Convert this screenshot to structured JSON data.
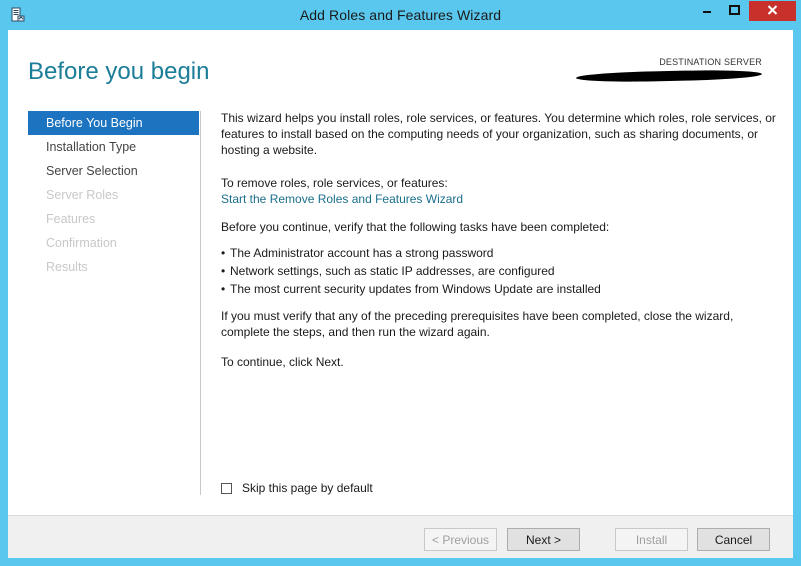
{
  "window": {
    "title": "Add Roles and Features Wizard",
    "accent_color": "#5ac8ee",
    "close_color": "#c7302b",
    "icons": {
      "app": "server-manager-icon",
      "minimize": "minimize-icon",
      "maximize": "maximize-icon",
      "close": "close-icon"
    }
  },
  "header": {
    "page_title": "Before you begin",
    "destination_label": "DESTINATION SERVER",
    "destination_value_redacted": true
  },
  "sidebar": {
    "items": [
      {
        "label": "Before You Begin",
        "state": "active"
      },
      {
        "label": "Installation Type",
        "state": "enabled"
      },
      {
        "label": "Server Selection",
        "state": "enabled"
      },
      {
        "label": "Server Roles",
        "state": "disabled"
      },
      {
        "label": "Features",
        "state": "disabled"
      },
      {
        "label": "Confirmation",
        "state": "disabled"
      },
      {
        "label": "Results",
        "state": "disabled"
      }
    ]
  },
  "content": {
    "intro": "This wizard helps you install roles, role services, or features. You determine which roles, role services, or features to install based on the computing needs of your organization, such as sharing documents, or hosting a website.",
    "remove_label": "To remove roles, role services, or features:",
    "remove_link": "Start the Remove Roles and Features Wizard",
    "verify_label": "Before you continue, verify that the following tasks have been completed:",
    "tasks": [
      "The Administrator account has a strong password",
      "Network settings, such as static IP addresses, are configured",
      "The most current security updates from Windows Update are installed"
    ],
    "prereq_note": "If you must verify that any of the preceding prerequisites have been completed, close the wizard, complete the steps, and then run the wizard again.",
    "continue_text": "To continue, click Next."
  },
  "options": {
    "skip_label": "Skip this page by default",
    "skip_checked": false
  },
  "footer": {
    "previous_label": "< Previous",
    "next_label": "Next >",
    "install_label": "Install",
    "cancel_label": "Cancel"
  }
}
